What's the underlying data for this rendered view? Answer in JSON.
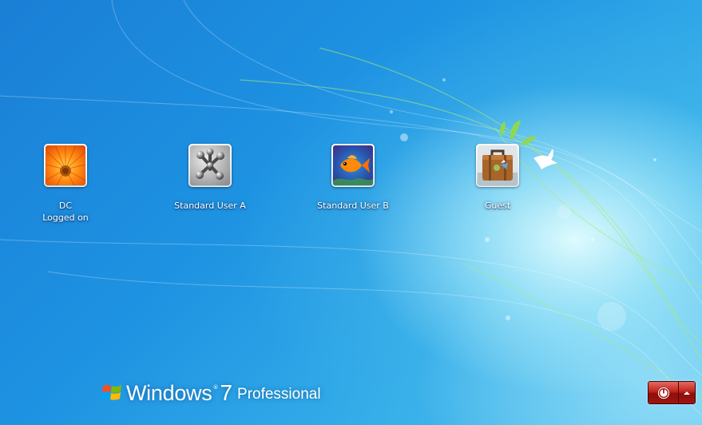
{
  "os": {
    "logo_word": "Windows",
    "logo_trademark": "®",
    "logo_version": "7",
    "edition": "Professional"
  },
  "users": [
    {
      "name": "DC",
      "status": "Logged on",
      "picture_icon": "orange-flower-icon"
    },
    {
      "name": "Standard User A",
      "status": "",
      "picture_icon": "jacks-icon"
    },
    {
      "name": "Standard User B",
      "status": "",
      "picture_icon": "orange-fish-icon"
    },
    {
      "name": "Guest",
      "status": "",
      "picture_icon": "suitcase-icon"
    }
  ],
  "controls": {
    "shutdown_icon": "power-icon",
    "options_icon": "arrow-up-icon"
  },
  "colors": {
    "background": "#1e93e2",
    "shutdown_button": "#c2241d",
    "text": "#ffffff"
  }
}
